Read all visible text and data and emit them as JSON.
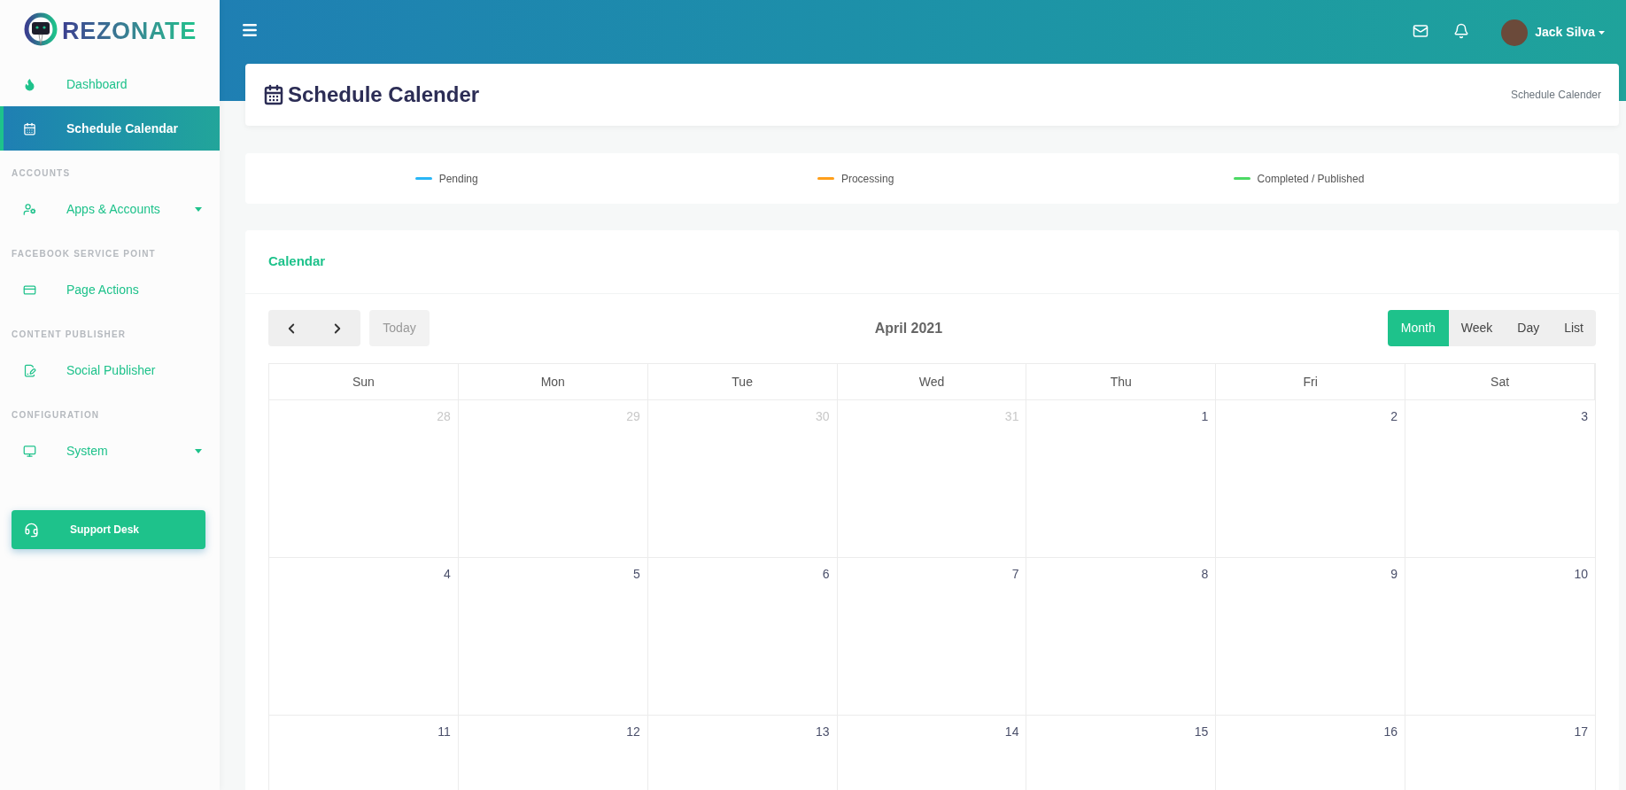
{
  "sidebar": {
    "logo_text": "REZONATE",
    "items": [
      {
        "kind": "link",
        "label": "Dashboard",
        "selected": false
      },
      {
        "kind": "link",
        "label": "Schedule Calendar",
        "selected": true
      },
      {
        "kind": "heading",
        "label": "ACCOUNTS"
      },
      {
        "kind": "link",
        "label": "Apps & Accounts",
        "selected": false,
        "expandable": true
      },
      {
        "kind": "heading",
        "label": "FACEBOOK SERVICE POINT"
      },
      {
        "kind": "link",
        "label": "Page Actions",
        "selected": false
      },
      {
        "kind": "heading",
        "label": "CONTENT PUBLISHER"
      },
      {
        "kind": "link",
        "label": "Social Publisher",
        "selected": false
      },
      {
        "kind": "heading",
        "label": "CONFIGURATION"
      },
      {
        "kind": "link",
        "label": "System",
        "selected": false,
        "expandable": true
      }
    ],
    "support_button": "Support Desk"
  },
  "topbar": {
    "user_name": "Jack Silva"
  },
  "page": {
    "title": "Schedule Calender",
    "breadcrumb": "Schedule Calender"
  },
  "legend": [
    {
      "label": "Pending",
      "color": "#29b6f6"
    },
    {
      "label": "Processing",
      "color": "#ff9f1a"
    },
    {
      "label": "Completed / Published",
      "color": "#4cd964"
    }
  ],
  "calendar": {
    "heading": "Calendar",
    "title": "April 2021",
    "today_button": {
      "label": "Today",
      "disabled": true
    },
    "views": [
      {
        "label": "Month",
        "selected": true
      },
      {
        "label": "Week",
        "selected": false
      },
      {
        "label": "Day",
        "selected": false
      },
      {
        "label": "List",
        "selected": false
      }
    ],
    "weekdays": [
      "Sun",
      "Mon",
      "Tue",
      "Wed",
      "Thu",
      "Fri",
      "Sat"
    ],
    "weeks": [
      [
        {
          "day": "28",
          "outside": true
        },
        {
          "day": "29",
          "outside": true
        },
        {
          "day": "30",
          "outside": true
        },
        {
          "day": "31",
          "outside": true
        },
        {
          "day": "1",
          "outside": false
        },
        {
          "day": "2",
          "outside": false
        },
        {
          "day": "3",
          "outside": false
        }
      ],
      [
        {
          "day": "4",
          "outside": false
        },
        {
          "day": "5",
          "outside": false
        },
        {
          "day": "6",
          "outside": false
        },
        {
          "day": "7",
          "outside": false
        },
        {
          "day": "8",
          "outside": false
        },
        {
          "day": "9",
          "outside": false
        },
        {
          "day": "10",
          "outside": false
        }
      ],
      [
        {
          "day": "11",
          "outside": false
        },
        {
          "day": "12",
          "outside": false
        },
        {
          "day": "13",
          "outside": false
        },
        {
          "day": "14",
          "outside": false
        },
        {
          "day": "15",
          "outside": false
        },
        {
          "day": "16",
          "outside": false
        },
        {
          "day": "17",
          "outside": false
        }
      ]
    ]
  }
}
